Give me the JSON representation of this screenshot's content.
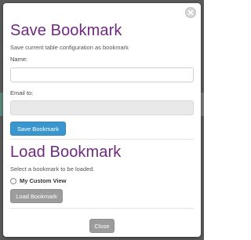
{
  "modal": {
    "save_section": {
      "title": "Save Bookmark",
      "description": "Save current table configuration as bookmark",
      "name_label": "Name:",
      "name_value": "",
      "email_label": "Email to:",
      "email_value": "",
      "save_button": "Save Bookmark"
    },
    "load_section": {
      "title": "Load Bookmark",
      "description": "Select a bookmark to be loaded.",
      "bookmarks": [
        {
          "label": "My Custom View",
          "selected": false
        }
      ],
      "load_button": "Load Bookmark"
    },
    "close_button": "Close",
    "close_icon": "close-circle-icon"
  },
  "colors": {
    "title": "#6f2a7f",
    "primary_button": "#3a96cf",
    "disabled_button": "#9c9c9c",
    "overlay": "#5b5b5b"
  }
}
